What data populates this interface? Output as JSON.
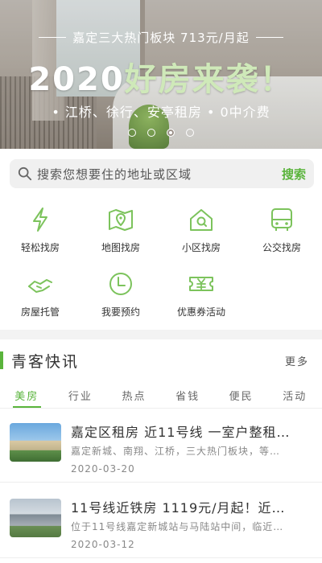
{
  "banner": {
    "top_line": "嘉定三大热门板块 713元/月起",
    "headline_a": "2020",
    "headline_b": "好房来袭！",
    "sub": "• 江桥、徐行、安亭租房  • 0中介费",
    "dots": 4,
    "active_dot": 2
  },
  "search": {
    "placeholder": "搜索您想要住的地址或区域",
    "button": "搜索"
  },
  "grid": {
    "items": [
      {
        "label": "轻松找房",
        "icon": "lightning-icon"
      },
      {
        "label": "地图找房",
        "icon": "map-pin-icon"
      },
      {
        "label": "小区找房",
        "icon": "house-icon"
      },
      {
        "label": "公交找房",
        "icon": "bus-icon"
      },
      {
        "label": "房屋托管",
        "icon": "handshake-icon"
      },
      {
        "label": "我要预约",
        "icon": "clock-icon"
      },
      {
        "label": "优惠券活动",
        "icon": "coupon-icon"
      }
    ]
  },
  "news": {
    "title": "青客快讯",
    "more": "更多",
    "tabs": [
      "美房",
      "行业",
      "热点",
      "省钱",
      "便民",
      "活动"
    ],
    "active_tab": 0,
    "articles": [
      {
        "title": "嘉定区租房 近11号线 一室户整租…",
        "desc": "嘉定新城、南翔、江桥，三大热门板块，等…",
        "date": "2020-03-20"
      },
      {
        "title": "11号线近铁房 1119元/月起！近…",
        "desc": "位于11号线嘉定新城站与马陆站中间，临近…",
        "date": "2020-03-12"
      }
    ]
  },
  "colors": {
    "accent": "#5ab43c",
    "icon_green": "#7cc35c"
  }
}
